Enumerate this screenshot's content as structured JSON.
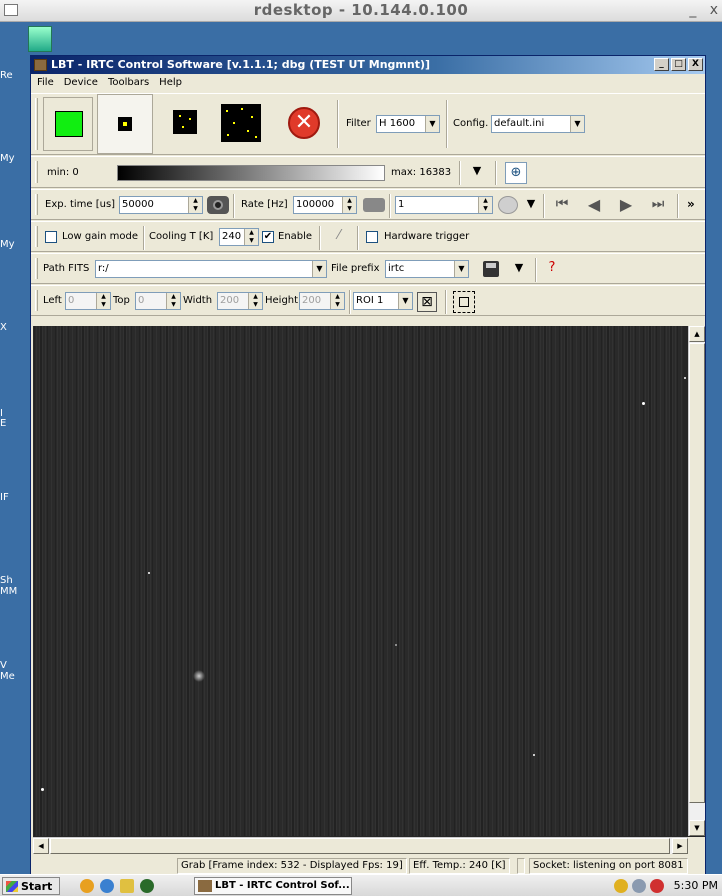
{
  "rdesktop": {
    "title": "rdesktop - 10.144.0.100",
    "minimize_label": "_",
    "close_label": "x"
  },
  "desktop": {
    "icon_labels": [
      "Re",
      "My",
      "My",
      "X",
      "I",
      "E",
      "IF",
      "Sh",
      "MM",
      "V",
      "Me"
    ]
  },
  "app": {
    "title": "LBT - IRTC Control Software [v.1.1.1; dbg (TEST UT Mngmnt)]",
    "min_btn": "_",
    "max_btn": "□",
    "close_btn": "X"
  },
  "menu": {
    "items": [
      "File",
      "Device",
      "Toolbars",
      "Help"
    ]
  },
  "toolbar1": {
    "filter_label": "Filter",
    "filter_value": "H 1600",
    "config_label": "Config.",
    "config_value": "default.ini"
  },
  "toolbar2": {
    "min_label": "min: 0",
    "max_label": "max: 16383"
  },
  "toolbar3": {
    "exp_label": "Exp. time [us]",
    "exp_value": "50000",
    "rate_label": "Rate [Hz]",
    "rate_value": "100000",
    "frames_value": "1",
    "more_label": "»"
  },
  "toolbar4": {
    "low_gain_label": "Low gain mode",
    "low_gain_checked": false,
    "cooling_label": "Cooling T [K]",
    "cooling_value": "240",
    "enable_label": "Enable",
    "enable_checked": true,
    "hw_trigger_label": "Hardware trigger",
    "hw_trigger_checked": false
  },
  "toolbar5": {
    "path_label": "Path FITS",
    "path_value": "r:/",
    "prefix_label": "File prefix",
    "prefix_value": "irtc"
  },
  "toolbar6": {
    "left_label": "Left",
    "left_value": "0",
    "top_label": "Top",
    "top_value": "0",
    "width_label": "Width",
    "width_value": "200",
    "height_label": "Height",
    "height_value": "200",
    "roi_value": "ROI 1"
  },
  "status": {
    "grab": "Grab [Frame index: 532 - Displayed Fps: 19]",
    "eff_temp": "Eff. Temp.: 240 [K]",
    "socket": "Socket: listening on port 8081"
  },
  "taskbar": {
    "start_label": "Start",
    "task_label": "LBT - IRTC Control Sof...",
    "clock": "5:30 PM"
  },
  "colors": {
    "green_button": "#11ee11",
    "stop_red": "#e03a2a",
    "title_blue": "#0a246a"
  }
}
